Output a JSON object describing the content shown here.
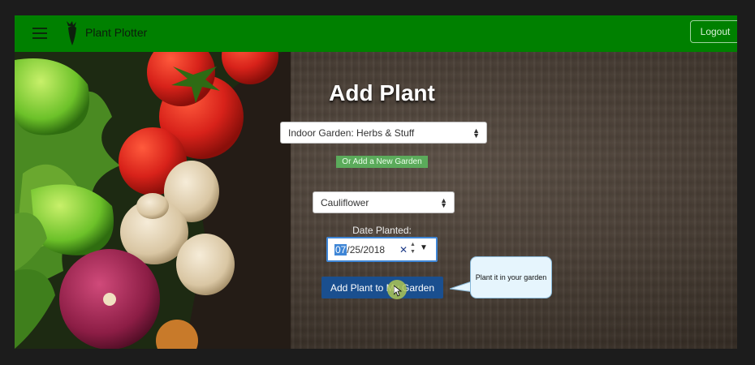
{
  "navbar": {
    "brand": "Plant Plotter",
    "logout_label": "Logout",
    "menu_icon": "hamburger-menu-icon",
    "logo_icon": "carrot-logo-icon",
    "color": "#008000"
  },
  "form": {
    "title": "Add Plant",
    "garden_select": {
      "value": "Indoor Garden: Herbs & Stuff"
    },
    "add_garden_label": "Or Add a New Garden",
    "plant_select": {
      "value": "Cauliflower"
    },
    "date_label": "Date Planted:",
    "date": {
      "month": "07",
      "rest": "/25/2018"
    },
    "submit_label": "Add Plant to My Garden"
  },
  "tooltip": {
    "text": "Plant it in your garden"
  },
  "colors": {
    "submit": "#1a4f8f",
    "add_garden": "#5bab5b",
    "focus": "#3f86d6"
  }
}
